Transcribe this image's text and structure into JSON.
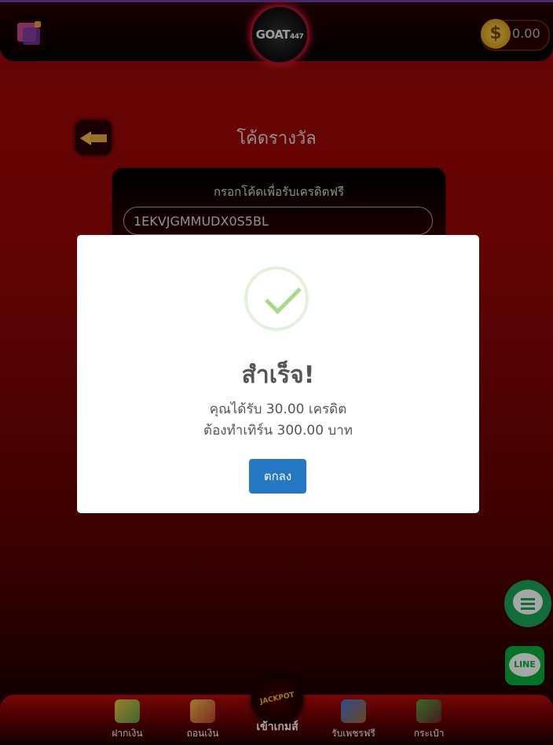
{
  "header": {
    "logo_text": "GOAT",
    "logo_number": "447",
    "balance": "0.00",
    "coin_symbol": "$"
  },
  "page": {
    "title": "โค้ดรางวัล",
    "card_label": "กรอกโค้ดเพื่อรับเครดิตฟรี",
    "code_value": "1EKVJGMMUDX0S5BL"
  },
  "modal": {
    "title": "สำเร็จ!",
    "line1": "คุณได้รับ 30.00 เครดิต",
    "line2": "ต้องทำเทิร์น 300.00 บาท",
    "ok_label": "ตกลง",
    "check_color": "#a5dc86",
    "button_color": "#2778c4"
  },
  "side": {
    "line_label": "LINE"
  },
  "bottom_nav": {
    "deposit": "ฝากเงิน",
    "withdraw": "ถอนเงิน",
    "game": "เข้าเกมส์",
    "jackpot_text": "JACKPOT",
    "free_diamond": "รับเพชรฟรี",
    "wallet": "กระเป๋า"
  }
}
